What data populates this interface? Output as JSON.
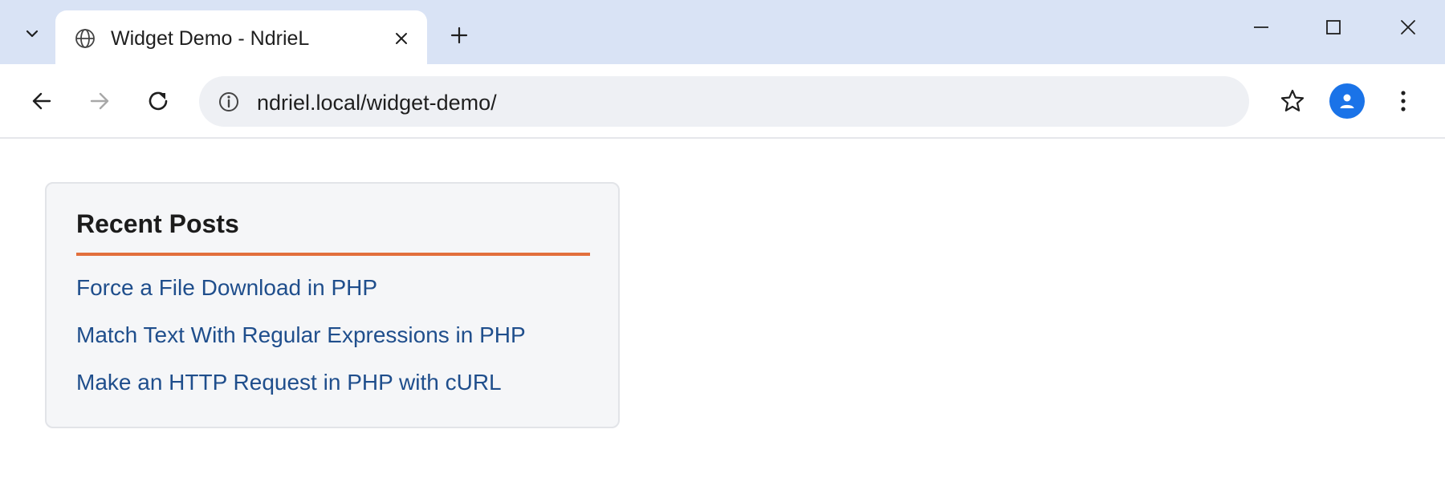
{
  "browser": {
    "tab": {
      "title": "Widget Demo - NdrieL",
      "favicon": "globe-icon"
    },
    "address_bar": {
      "url": "ndriel.local/widget-demo/"
    },
    "avatar_color": "#1a73e8",
    "tabstrip_color": "#d9e3f5"
  },
  "widget": {
    "title": "Recent Posts",
    "accent_color": "#e2703d",
    "link_color": "#1f4e8c",
    "posts": [
      {
        "label": "Force a File Download in PHP"
      },
      {
        "label": "Match Text With Regular Expressions in PHP"
      },
      {
        "label": "Make an HTTP Request in PHP with cURL"
      }
    ]
  }
}
